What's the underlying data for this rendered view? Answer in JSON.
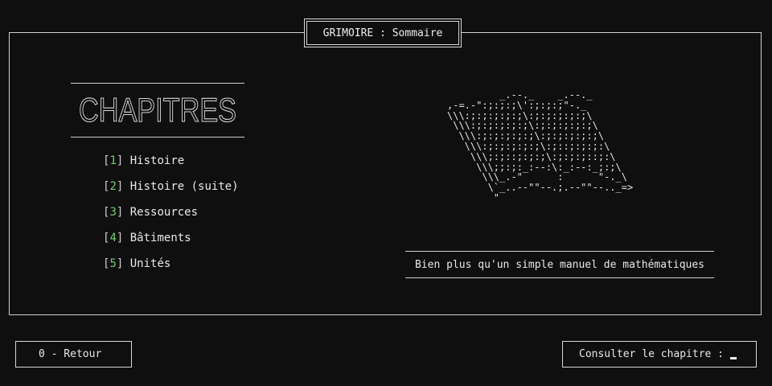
{
  "header": {
    "title": "GRIMOIRE : Sommaire"
  },
  "section": {
    "heading": "CHAPITRES"
  },
  "menu": {
    "items": [
      {
        "num": "1",
        "label": "Histoire"
      },
      {
        "num": "2",
        "label": "Histoire (suite)"
      },
      {
        "num": "3",
        "label": "Ressources"
      },
      {
        "num": "4",
        "label": "Bâtiments"
      },
      {
        "num": "5",
        "label": "Unités"
      }
    ]
  },
  "art": {
    "book": "         _.--._    _.--._\n,-=.-\":;:;:;\\':;:;:;\"-._\n\\\\\\:;:;:;:;:;\\:;:;:;:;:;\\\n \\\\\\:;:;:;:;:;\\:;:;:;:;:;\\\n  \\\\\\:;:;:;:;:;\\:;:;:;:;:;\\\n   \\\\\\:;:;:;:;:;\\:;::;:;:;:\\\n    \\\\\\;:;::;:;:;\\:;:;:;::;:\\\n     \\\\\\;;:;:_:--:\\:_:--:_;:;\\\n      \\\\\\_.-\"      :      \"-._\\\n       \\`_..--\"\"--.;.--\"\"--.._=>\n        \""
  },
  "tagline": "Bien plus qu'un simple manuel de mathématiques",
  "footer": {
    "back_label": "0 - Retour",
    "prompt_label": "Consulter le chapitre :"
  }
}
